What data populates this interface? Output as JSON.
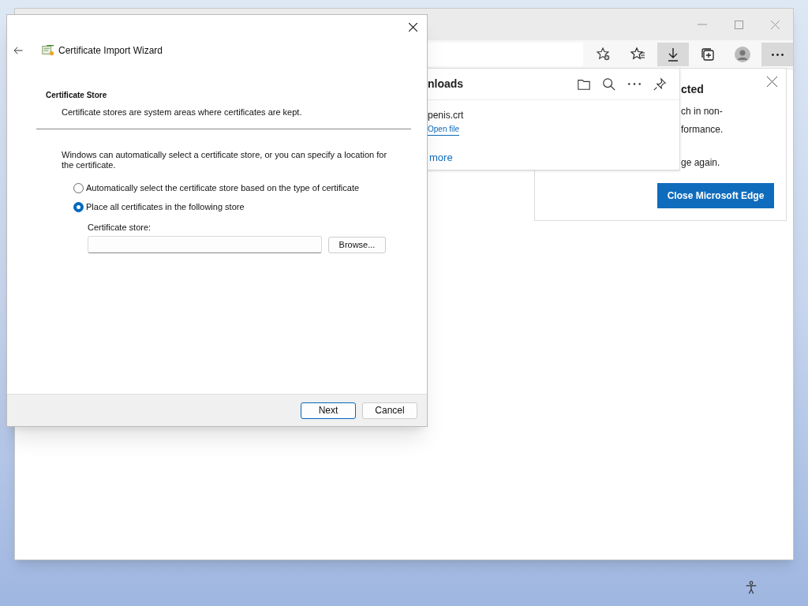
{
  "browser": {
    "toolbar": [
      {
        "kind": "add-favorite",
        "selected": false
      },
      {
        "kind": "favorites",
        "selected": false
      },
      {
        "kind": "downloads",
        "selected": true
      },
      {
        "kind": "collections",
        "selected": false
      },
      {
        "kind": "profile",
        "selected": false
      },
      {
        "kind": "more",
        "selected": true
      }
    ],
    "downloads": {
      "title": "nloads",
      "file": "penis.crt",
      "open_link": "Open file",
      "more_link": "more"
    },
    "notice": {
      "title": "cted",
      "lines": [
        "ch in non-",
        "formance.",
        "ge again."
      ],
      "button": "Close Microsoft Edge"
    }
  },
  "wizard": {
    "title": "Certificate Import Wizard",
    "heading": "Certificate Store",
    "subheading": "Certificate stores are system areas where certificates are kept.",
    "intro": "Windows can automatically select a certificate store, or you can specify a location for the certificate.",
    "options": [
      {
        "label": "Automatically select the certificate store based on the type of certificate",
        "selected": false
      },
      {
        "label": "Place all certificates in the following store",
        "selected": true
      }
    ],
    "store_label": "Certificate store:",
    "browse": "Browse...",
    "buttons": [
      {
        "label": "Next",
        "kind": "default"
      },
      {
        "label": "Cancel",
        "kind": "normal"
      }
    ]
  }
}
